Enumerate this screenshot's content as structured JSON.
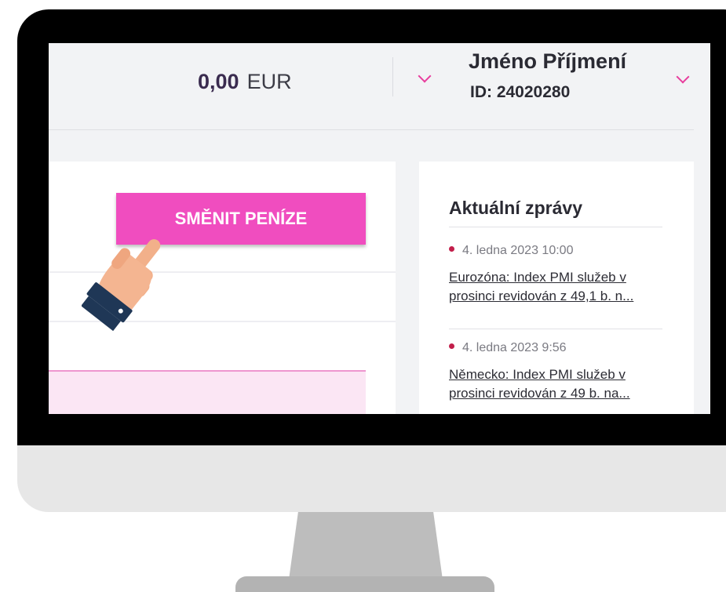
{
  "header": {
    "balance_amount": "0,00",
    "balance_currency": "EUR",
    "user_name": "Jméno Příjmení",
    "user_id": "ID: 24020280"
  },
  "main": {
    "exchange_button_label": "SMĚNIT PENÍZE"
  },
  "news": {
    "title": "Aktuální zprávy",
    "items": [
      {
        "date": "4. ledna 2023 10:00",
        "lines": [
          "Eurozóna: Index PMI služeb v",
          "prosinci revidován z 49,1 b. n..."
        ]
      },
      {
        "date": "4. ledna 2023 9:56",
        "lines": [
          "Německo: Index PMI služeb v",
          "prosinci revidován z 49 b. na..."
        ]
      }
    ]
  },
  "colors": {
    "accent_pink": "#f04dbf",
    "chevron_pink": "#e83d9d",
    "news_dot": "#c21e4a",
    "balance_text": "#3a2b4f"
  }
}
